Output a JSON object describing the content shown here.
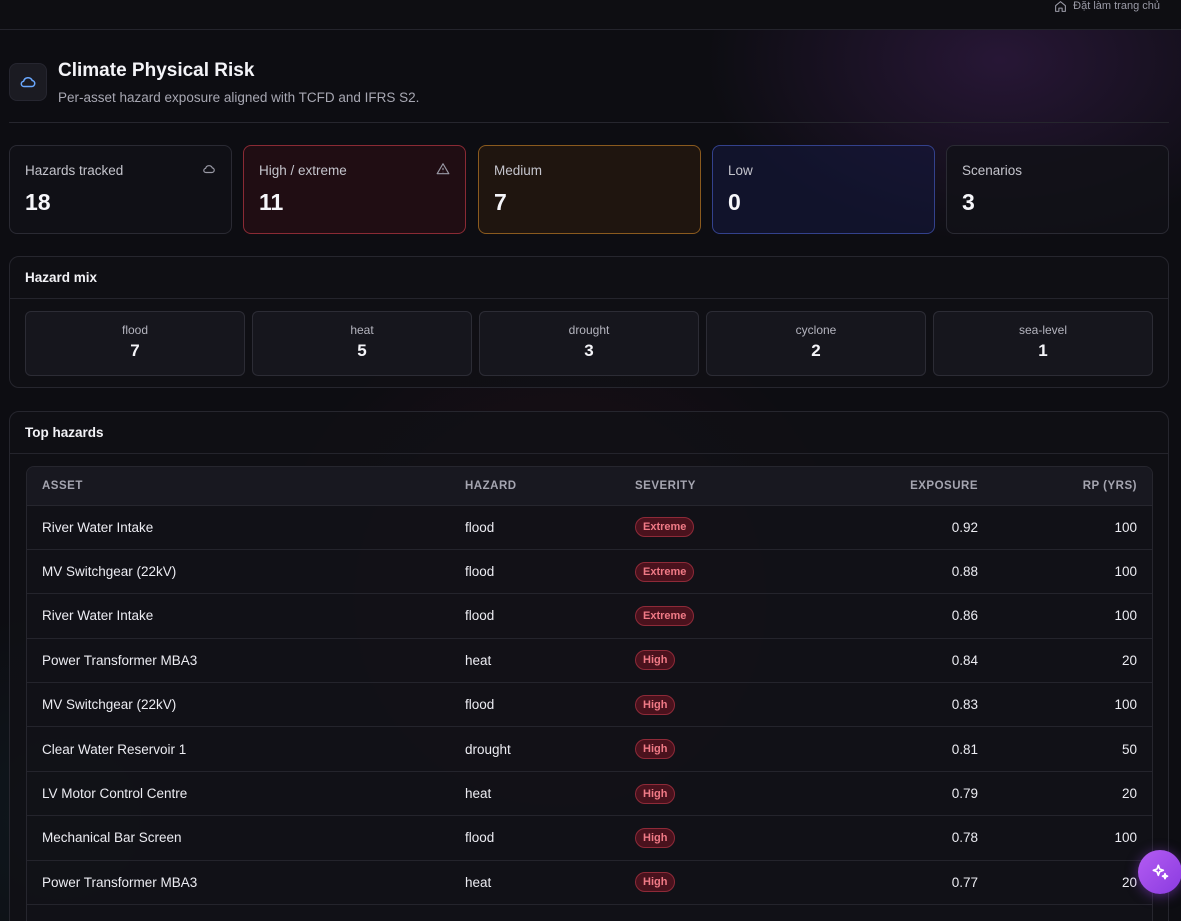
{
  "topbar": {
    "home_label": "Đặt làm trang chủ",
    "home_icon": "home-icon"
  },
  "header": {
    "icon": "cloud-icon",
    "title": "Climate Physical Risk",
    "subtitle": "Per-asset hazard exposure aligned with TCFD and IFRS S2."
  },
  "stats": [
    {
      "label": "Hazards tracked",
      "value": "18",
      "icon": "cloud-icon"
    },
    {
      "label": "High / extreme",
      "value": "11",
      "icon": "warning-icon"
    },
    {
      "label": "Medium",
      "value": "7"
    },
    {
      "label": "Low",
      "value": "0"
    },
    {
      "label": "Scenarios",
      "value": "3"
    }
  ],
  "hazard_mix": {
    "title": "Hazard mix",
    "items": [
      {
        "name": "flood",
        "count": "7"
      },
      {
        "name": "heat",
        "count": "5"
      },
      {
        "name": "drought",
        "count": "3"
      },
      {
        "name": "cyclone",
        "count": "2"
      },
      {
        "name": "sea-level",
        "count": "1"
      }
    ]
  },
  "top_hazards": {
    "title": "Top hazards",
    "columns": [
      "ASSET",
      "HAZARD",
      "SEVERITY",
      "EXPOSURE",
      "RP (YRS)"
    ],
    "rows": [
      {
        "asset": "River Water Intake",
        "hazard": "flood",
        "severity": "Extreme",
        "exposure": "0.92",
        "rp": "100"
      },
      {
        "asset": "MV Switchgear (22kV)",
        "hazard": "flood",
        "severity": "Extreme",
        "exposure": "0.88",
        "rp": "100"
      },
      {
        "asset": "River Water Intake",
        "hazard": "flood",
        "severity": "Extreme",
        "exposure": "0.86",
        "rp": "100"
      },
      {
        "asset": "Power Transformer MBA3",
        "hazard": "heat",
        "severity": "High",
        "exposure": "0.84",
        "rp": "20"
      },
      {
        "asset": "MV Switchgear (22kV)",
        "hazard": "flood",
        "severity": "High",
        "exposure": "0.83",
        "rp": "100"
      },
      {
        "asset": "Clear Water Reservoir 1",
        "hazard": "drought",
        "severity": "High",
        "exposure": "0.81",
        "rp": "50"
      },
      {
        "asset": "LV Motor Control Centre",
        "hazard": "heat",
        "severity": "High",
        "exposure": "0.79",
        "rp": "20"
      },
      {
        "asset": "Mechanical Bar Screen",
        "hazard": "flood",
        "severity": "High",
        "exposure": "0.78",
        "rp": "100"
      },
      {
        "asset": "Power Transformer MBA3",
        "hazard": "heat",
        "severity": "High",
        "exposure": "0.77",
        "rp": "20"
      }
    ]
  },
  "fab": {
    "icon": "sparkles-icon"
  },
  "colors": {
    "background": "#0d0d12",
    "extreme_badge_text": "#f07a86",
    "high_border": "#8a2a34",
    "medium_border": "#8a5a1e",
    "low_border": "#33418c",
    "fab": "#a64cf0"
  }
}
